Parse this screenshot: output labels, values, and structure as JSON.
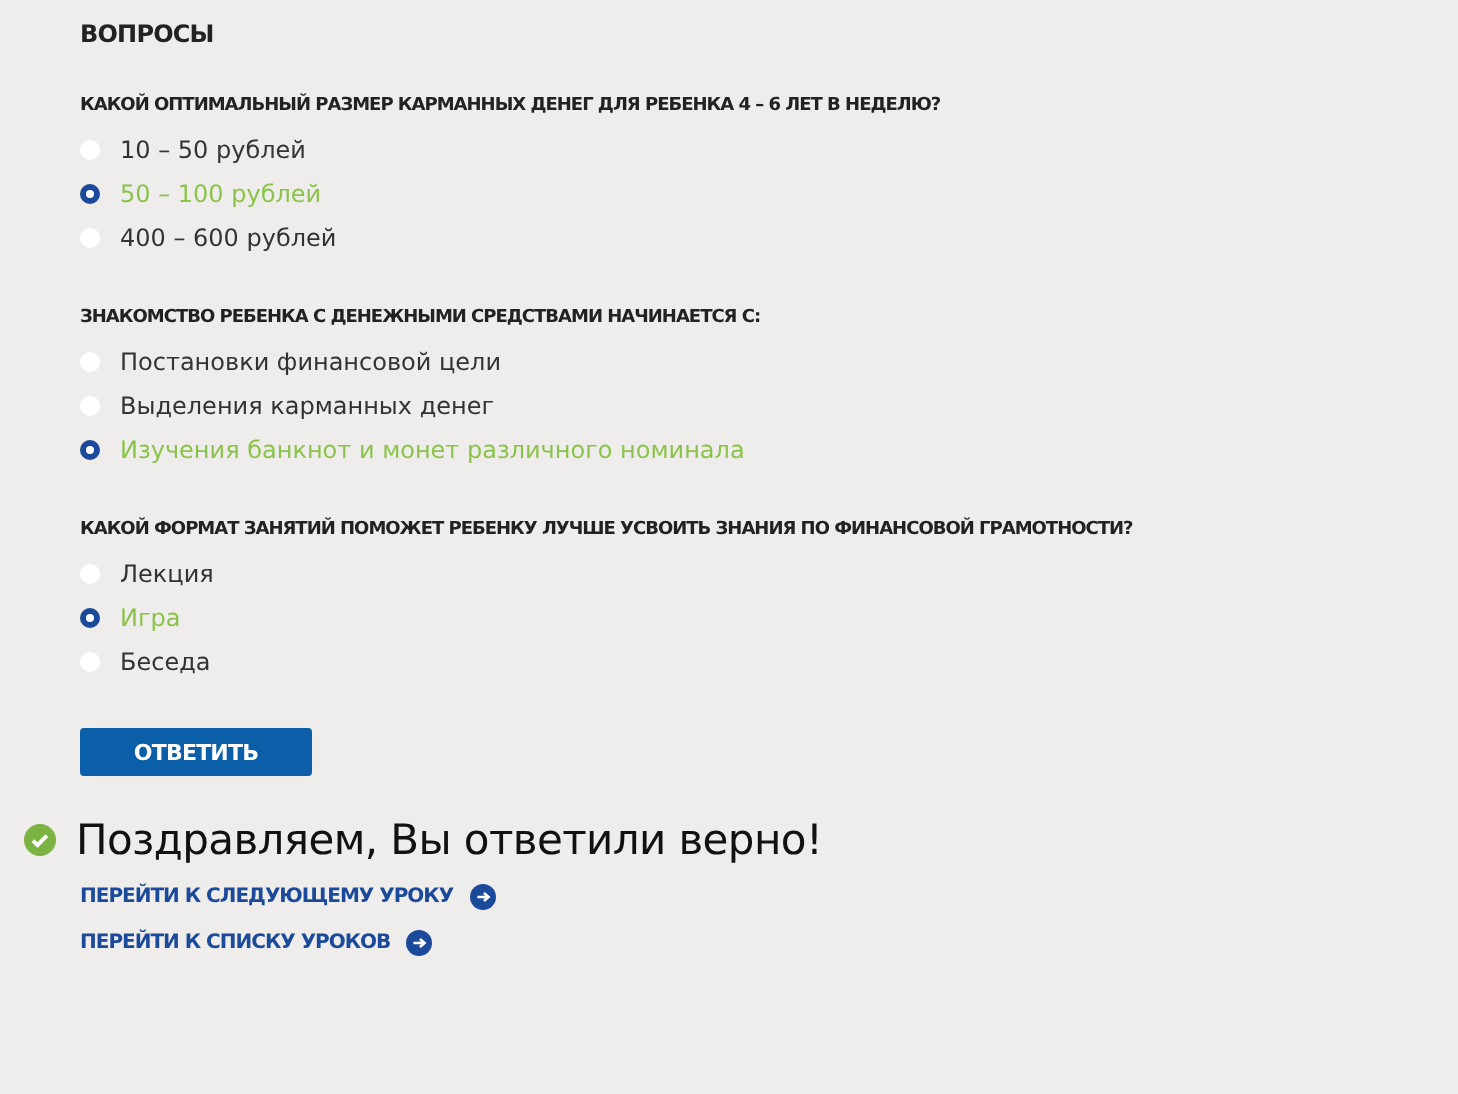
{
  "section_title": "ВОПРОСЫ",
  "questions": [
    {
      "text": "КАКОЙ ОПТИМАЛЬНЫЙ РАЗМЕР КАРМАННЫХ ДЕНЕГ ДЛЯ РЕБЕНКА 4 – 6 ЛЕТ В НЕДЕЛЮ?",
      "options": [
        {
          "label": "10 – 50 рублей",
          "selected": false
        },
        {
          "label": "50 – 100 рублей",
          "selected": true
        },
        {
          "label": "400 – 600 рублей",
          "selected": false
        }
      ]
    },
    {
      "text": "ЗНАКОМСТВО РЕБЕНКА С ДЕНЕЖНЫМИ СРЕДСТВАМИ НАЧИНАЕТСЯ С:",
      "options": [
        {
          "label": "Постановки финансовой цели",
          "selected": false
        },
        {
          "label": "Выделения карманных денег",
          "selected": false
        },
        {
          "label": "Изучения банкнот и монет различного номинала",
          "selected": true
        }
      ]
    },
    {
      "text": "КАКОЙ ФОРМАТ ЗАНЯТИЙ ПОМОЖЕТ РЕБЕНКУ ЛУЧШЕ УСВОИТЬ ЗНАНИЯ ПО ФИНАНСОВОЙ ГРАМОТНОСТИ?",
      "options": [
        {
          "label": "Лекция",
          "selected": false
        },
        {
          "label": "Игра",
          "selected": true
        },
        {
          "label": "Беседа",
          "selected": false
        }
      ]
    }
  ],
  "submit_button": "ОТВЕТИТЬ",
  "result": {
    "text": "Поздравляем, Вы ответили верно!"
  },
  "links": [
    "ПЕРЕЙТИ К СЛЕДУЮЩЕМУ УРОКУ",
    "ПЕРЕЙТИ К СПИСКУ УРОКОВ"
  ]
}
